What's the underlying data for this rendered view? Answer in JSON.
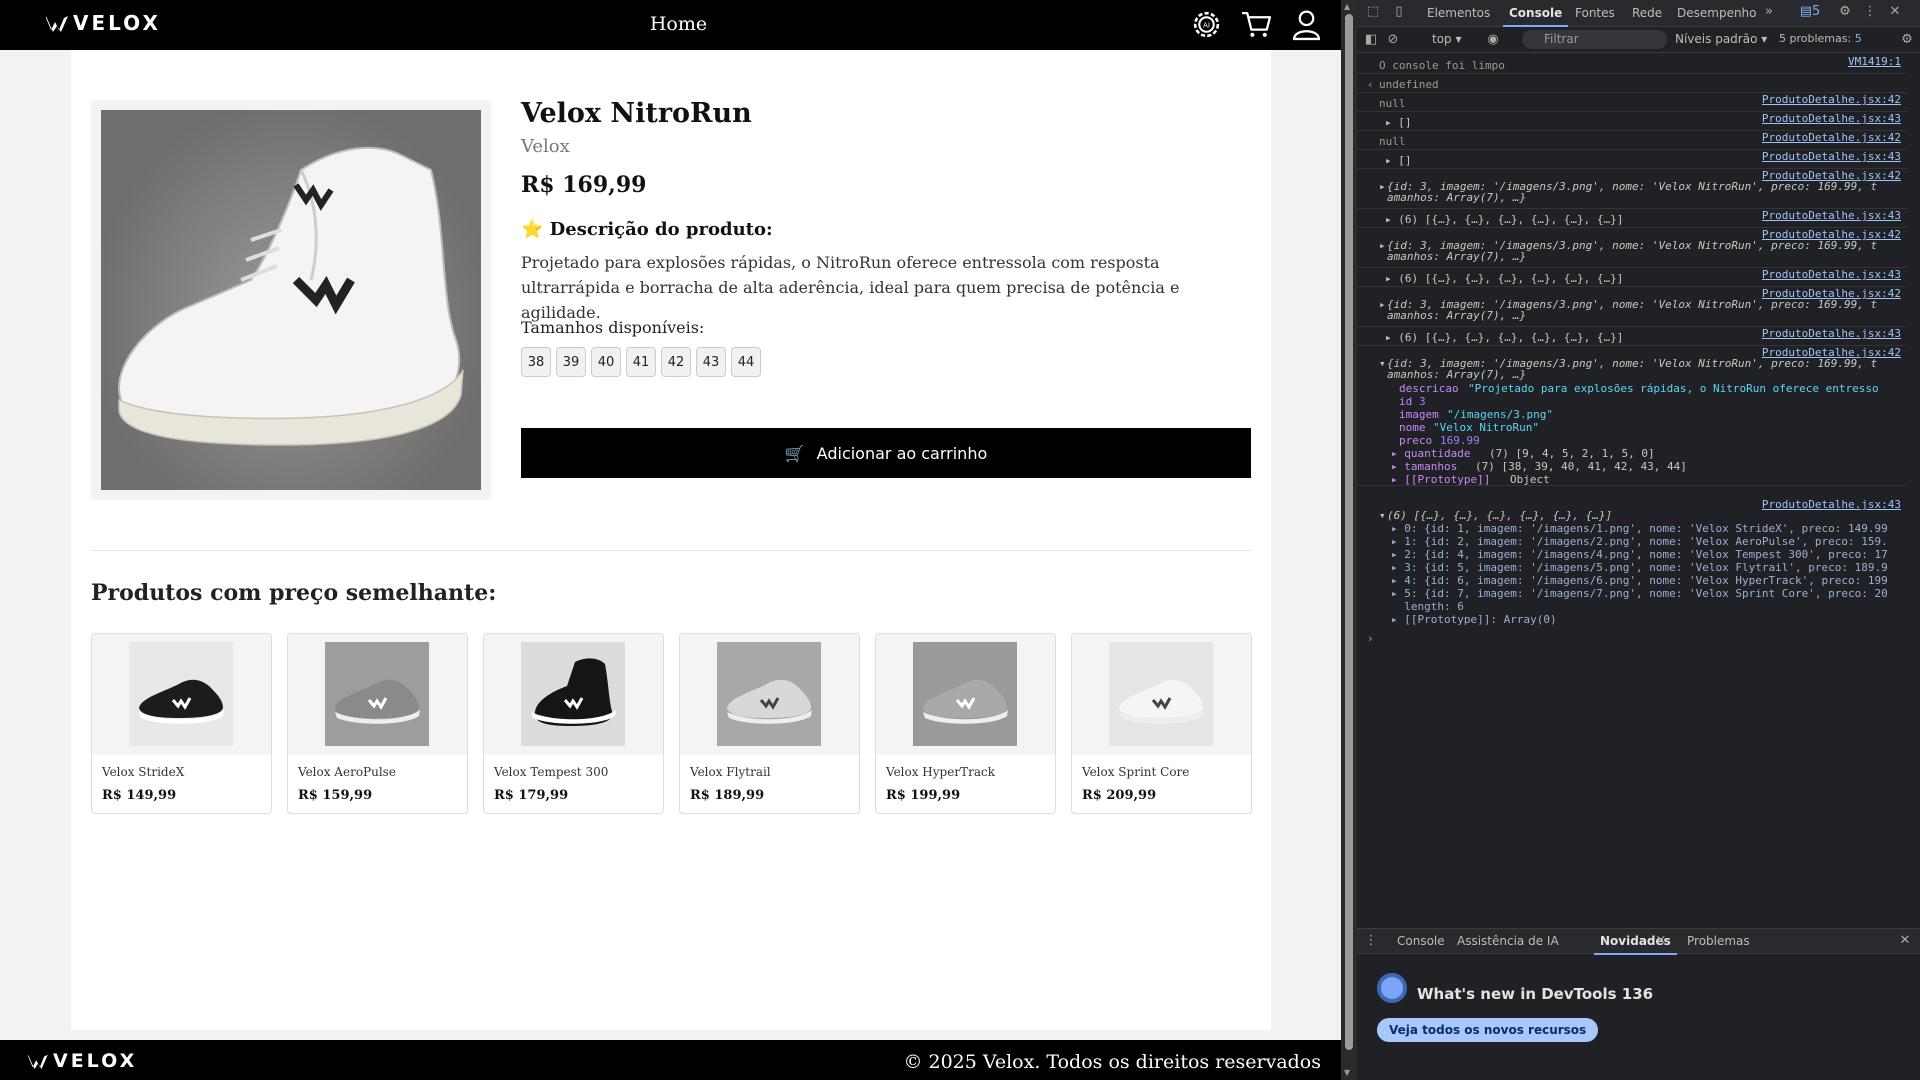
{
  "site": {
    "brand": "VELOX",
    "header_title": "Home",
    "footer_copyright": "© 2025 Velox. Todos os direitos reservados"
  },
  "product": {
    "name": "Velox NitroRun",
    "brand": "Velox",
    "price": "R$ 169,99",
    "description_title": "⭐ Descrição do produto:",
    "description": "Projetado para explosões rápidas, o NitroRun oferece entressola com resposta ultrarrápida e borracha de alta aderência, ideal para quem precisa de potência e agilidade.",
    "sizes_label": "Tamanhos disponíveis:",
    "sizes": [
      "38",
      "39",
      "40",
      "41",
      "42",
      "43",
      "44"
    ],
    "add_to_cart": "Adicionar ao carrinho",
    "cart_emoji": "🛒"
  },
  "similar": {
    "title": "Produtos com preço semelhante:",
    "items": [
      {
        "name": "Velox StrideX",
        "price": "R$ 149,99",
        "shoe": "black"
      },
      {
        "name": "Velox AeroPulse",
        "price": "R$ 159,99",
        "shoe": "grey"
      },
      {
        "name": "Velox Tempest 300",
        "price": "R$ 179,99",
        "shoe": "black-high"
      },
      {
        "name": "Velox Flytrail",
        "price": "R$ 189,99",
        "shoe": "light-grey"
      },
      {
        "name": "Velox HyperTrack",
        "price": "R$ 199,99",
        "shoe": "grey-retro"
      },
      {
        "name": "Velox Sprint Core",
        "price": "R$ 209,99",
        "shoe": "white"
      }
    ]
  },
  "devtools": {
    "tabs": [
      "Elementos",
      "Console",
      "Fontes",
      "Rede",
      "Desempenho"
    ],
    "active_tab": "Console",
    "issues_badge": "5",
    "toolbar": {
      "context": "top",
      "filter_placeholder": "Filtrar",
      "levels": "Níveis padrão",
      "problems": "5 problemas:",
      "problems_count": "5"
    },
    "console_lines": [
      {
        "text": "O console foi limpo",
        "src": "VM1419:1",
        "style": "muted"
      },
      {
        "text": "undefined",
        "src": "",
        "style": "muted",
        "prefix": "‹"
      },
      {
        "text": "null",
        "src": "ProdutoDetalhe.jsx:42",
        "style": "muted"
      },
      {
        "text": "▸ []",
        "src": "ProdutoDetalhe.jsx:43",
        "style": "plain"
      },
      {
        "text": "null",
        "src": "ProdutoDetalhe.jsx:42",
        "style": "muted"
      },
      {
        "text": "▸ []",
        "src": "ProdutoDetalhe.jsx:43",
        "style": "plain"
      },
      {
        "text": "{id: 3, imagem: '/imagens/3.png', nome: 'Velox NitroRun', preco: 169.99, t",
        "cont": "amanhos: Array(7), …}",
        "src": "ProdutoDetalhe.jsx:42",
        "style": "obj"
      },
      {
        "text": "▸ (6) [{…}, {…}, {…}, {…}, {…}, {…}]",
        "src": "ProdutoDetalhe.jsx:43",
        "style": "plain"
      },
      {
        "text": "{id: 3, imagem: '/imagens/3.png', nome: 'Velox NitroRun', preco: 169.99, t",
        "cont": "amanhos: Array(7), …}",
        "src": "ProdutoDetalhe.jsx:42",
        "style": "obj"
      },
      {
        "text": "▸ (6) [{…}, {…}, {…}, {…}, {…}, {…}]",
        "src": "ProdutoDetalhe.jsx:43",
        "style": "plain"
      },
      {
        "text": "{id: 3, imagem: '/imagens/3.png', nome: 'Velox NitroRun', preco: 169.99, t",
        "cont": "amanhos: Array(7), …}",
        "src": "ProdutoDetalhe.jsx:42",
        "style": "obj"
      },
      {
        "text": "▸ (6) [{…}, {…}, {…}, {…}, {…}, {…}]",
        "src": "ProdutoDetalhe.jsx:43",
        "style": "plain"
      }
    ],
    "expanded_object": {
      "header": "{id: 3, imagem: '/imagens/3.png', nome: 'Velox NitroRun', preco: 169.99, t",
      "header_cont": "amanhos: Array(7), …}",
      "src": "ProdutoDetalhe.jsx:42",
      "props": [
        {
          "k": "descricao",
          "v": "\"Projetado para explosões rápidas, o NitroRun oferece entresso"
        },
        {
          "k": "id",
          "v": "3"
        },
        {
          "k": "imagem",
          "v": "\"/imagens/3.png\""
        },
        {
          "k": "nome",
          "v": "\"Velox NitroRun\""
        },
        {
          "k": "preco",
          "v": "169.99"
        },
        {
          "k": "▸ quantidade",
          "v": "(7) [9, 4, 5, 2, 1, 5, 0]"
        },
        {
          "k": "▸ tamanhos",
          "v": "(7) [38, 39, 40, 41, 42, 43, 44]"
        },
        {
          "k": "▸ [[Prototype]]",
          "v": "Object"
        }
      ]
    },
    "expanded_array": {
      "header": "(6) [{…}, {…}, {…}, {…}, {…}, {…}]",
      "src": "ProdutoDetalhe.jsx:43",
      "items": [
        "▸ 0: {id: 1, imagem: '/imagens/1.png', nome: 'Velox StrideX', preco: 149.99",
        "▸ 1: {id: 2, imagem: '/imagens/2.png', nome: 'Velox AeroPulse', preco: 159.",
        "▸ 2: {id: 4, imagem: '/imagens/4.png', nome: 'Velox Tempest 300', preco: 17",
        "▸ 3: {id: 5, imagem: '/imagens/5.png', nome: 'Velox Flytrail', preco: 189.9",
        "▸ 4: {id: 6, imagem: '/imagens/6.png', nome: 'Velox HyperTrack', preco: 199",
        "▸ 5: {id: 7, imagem: '/imagens/7.png', nome: 'Velox Sprint Core', preco: 20",
        "  length: 6",
        "▸ [[Prototype]]: Array(0)"
      ]
    },
    "drawer_tabs": [
      "Console",
      "Assistência de IA",
      "Novidades",
      "Problemas"
    ],
    "drawer_active": "Novidades",
    "whats_new_title": "What's new in DevTools 136",
    "whats_new_button": "Veja todos os novos recursos"
  }
}
